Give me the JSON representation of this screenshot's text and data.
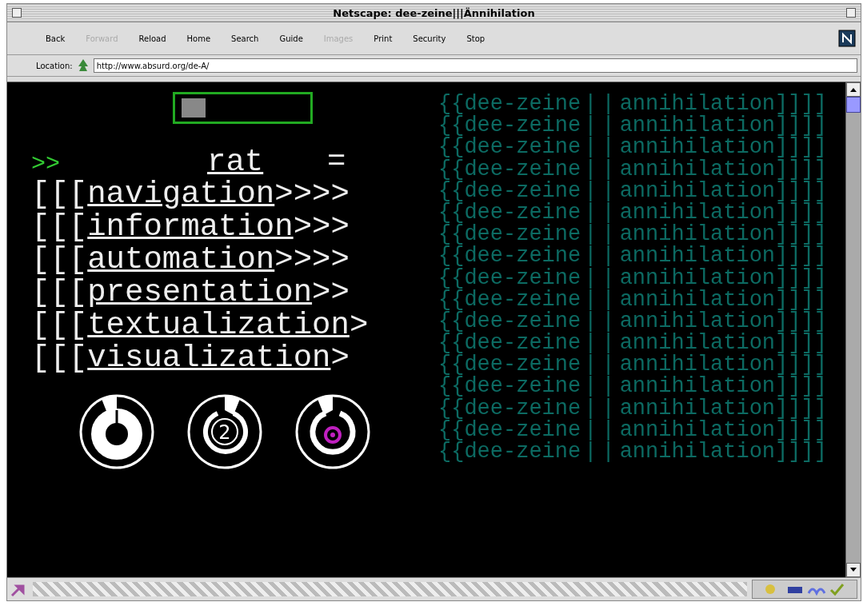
{
  "window": {
    "title": "Netscape: dee-zeine|||Ännihilation"
  },
  "toolbar": {
    "buttons": [
      {
        "label": "Back",
        "disabled": false
      },
      {
        "label": "Forward",
        "disabled": true
      },
      {
        "label": "Reload",
        "disabled": false
      },
      {
        "label": "Home",
        "disabled": false
      },
      {
        "label": "Search",
        "disabled": false
      },
      {
        "label": "Guide",
        "disabled": false
      },
      {
        "label": "Images",
        "disabled": true
      },
      {
        "label": "Print",
        "disabled": false
      },
      {
        "label": "Security",
        "disabled": false
      },
      {
        "label": "Stop",
        "disabled": false
      }
    ]
  },
  "location": {
    "label": "Location:",
    "value": "http://www.absurd.org/de-A/"
  },
  "page": {
    "prompt": ">>",
    "header_link": "rat",
    "header_sign": "=",
    "menu": [
      {
        "prefix": "[[[",
        "link": "navigation",
        "suffix": ">>>>"
      },
      {
        "prefix": "[[[",
        "link": "information",
        "suffix": ">>>"
      },
      {
        "prefix": "[[[",
        "link": "automation",
        "suffix": ">>>>"
      },
      {
        "prefix": "[[[",
        "link": "presentation",
        "suffix": ">>"
      },
      {
        "prefix": "[[[",
        "link": "textualization",
        "suffix": ">"
      },
      {
        "prefix": "[[[",
        "link": "visualization",
        "suffix": ">"
      }
    ],
    "dials": [
      {
        "kind": "ring"
      },
      {
        "kind": "number",
        "label": "2"
      },
      {
        "kind": "dot"
      }
    ],
    "rows": [
      {
        "left": "{{dee-zeine",
        "sep": "||",
        "right": "annihilation]]]]"
      },
      {
        "left": "{{dee-zeine",
        "sep": "||",
        "right": "annihilation]]]]"
      },
      {
        "left": "{{dee-zeine",
        "sep": "||",
        "right": "annihilation]]]]"
      },
      {
        "left": "{{dee-zeine",
        "sep": "||",
        "right": "annihilation]]]]"
      },
      {
        "left": "{{dee-zeine",
        "sep": "||",
        "right": "annihilation]]]]"
      },
      {
        "left": "{{dee-zeine",
        "sep": "||",
        "right": "annihilation]]]]"
      },
      {
        "left": "{{dee-zeine",
        "sep": "||",
        "right": "annihilation]]]]"
      },
      {
        "left": "{{dee-zeine",
        "sep": "||",
        "right": "annihilation]]]]"
      },
      {
        "left": "{{dee-zeine",
        "sep": "||",
        "right": "annihilation]]]]"
      },
      {
        "left": "{{dee-zeine",
        "sep": "||",
        "right": "annihilation]]]]"
      },
      {
        "left": "{{dee-zeine",
        "sep": "||",
        "right": "annihilation]]]]"
      },
      {
        "left": "{{dee-zeine",
        "sep": "||",
        "right": "annihilation]]]]"
      },
      {
        "left": "{{dee-zeine",
        "sep": "||",
        "right": "annihilation]]]]"
      },
      {
        "left": "{{dee-zeine",
        "sep": "||",
        "right": "annihilation]]]]"
      },
      {
        "left": "{{dee-zeine",
        "sep": "||",
        "right": "annihilation]]]]"
      },
      {
        "left": "{{dee-zeine",
        "sep": "||",
        "right": "annihilation]]]]"
      },
      {
        "left": "{{dee-zeine",
        "sep": "||",
        "right": "annihilation]]]]"
      }
    ]
  }
}
